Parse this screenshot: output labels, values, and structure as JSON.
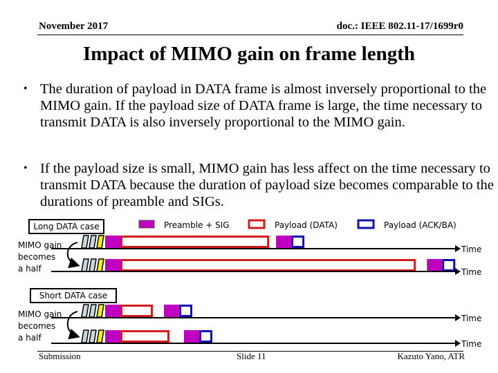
{
  "header": {
    "date": "November 2017",
    "doc_id": "doc.: IEEE 802.11-17/1699r0"
  },
  "title": "Impact of MIMO gain on frame length",
  "bullets": [
    "The duration of payload in DATA frame is almost inversely proportional to the MIMO gain. If the payload size of DATA frame is large, the time necessary to transmit DATA is also inversely proportional to the MIMO gain.",
    "If the payload size is small, MIMO gain has less affect on the time necessary to transmit DATA because the duration of payload size becomes comparable to the durations of preamble and SIGs."
  ],
  "legend": {
    "preamble": "Preamble + SIG",
    "payload_data": "Payload (DATA)",
    "payload_ack": "Payload (ACK/BA)"
  },
  "colors": {
    "preamble": "#c000c0",
    "payload_data": "#d01c1c",
    "payload_ack": "#1010b0",
    "stream_box": "#c8d8e0",
    "stream_yellow": "#f5f000"
  },
  "diagram": {
    "cases": [
      {
        "label": "Long DATA case",
        "gain_note": "MIMO gain becomes a half",
        "rows": [
          {
            "axis_label": "Time",
            "data_payload_units": 21,
            "ack_gap_units": 1
          },
          {
            "axis_label": "Time",
            "data_payload_units": 42,
            "ack_gap_units": 2
          }
        ]
      },
      {
        "label": "Short DATA case",
        "gain_note": "MIMO gain becomes a half",
        "rows": [
          {
            "axis_label": "Time",
            "data_payload_units": 1,
            "ack_gap_units": 1
          },
          {
            "axis_label": "Time",
            "data_payload_units": 2,
            "ack_gap_units": 1
          }
        ]
      }
    ],
    "gain_note_lines": [
      "MIMO gain",
      "becomes",
      "a half"
    ]
  },
  "footer": {
    "left": "Submission",
    "center": "Slide 11",
    "right": "Kazuto Yano, ATR"
  }
}
